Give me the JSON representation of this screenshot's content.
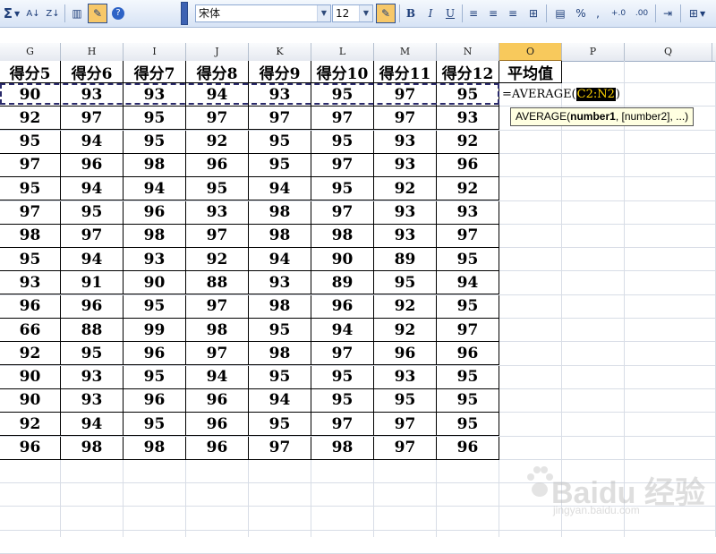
{
  "toolbar": {
    "sum_icon_label": "Σ",
    "font_name": "宋体",
    "font_size": "12",
    "bold": "B",
    "italic": "I",
    "underline": "U",
    "percent": "%",
    "comma": ",",
    "inc_decimal": "+.0",
    "dec_decimal": ".00"
  },
  "columns": [
    "G",
    "H",
    "I",
    "J",
    "K",
    "L",
    "M",
    "N",
    "O",
    "P",
    "Q"
  ],
  "active_column": "O",
  "headers": [
    "得分5",
    "得分6",
    "得分7",
    "得分8",
    "得分9",
    "得分10",
    "得分11",
    "得分12",
    "平均值"
  ],
  "rows": [
    [
      90,
      93,
      93,
      94,
      93,
      95,
      97,
      95
    ],
    [
      92,
      97,
      95,
      97,
      97,
      97,
      97,
      93
    ],
    [
      95,
      94,
      95,
      92,
      95,
      95,
      93,
      92
    ],
    [
      97,
      96,
      98,
      96,
      95,
      97,
      93,
      96
    ],
    [
      95,
      94,
      94,
      95,
      94,
      95,
      92,
      92
    ],
    [
      97,
      95,
      96,
      93,
      98,
      97,
      93,
      93
    ],
    [
      98,
      97,
      98,
      97,
      98,
      98,
      93,
      97
    ],
    [
      95,
      94,
      93,
      92,
      94,
      90,
      89,
      95
    ],
    [
      93,
      91,
      90,
      88,
      93,
      89,
      95,
      94
    ],
    [
      96,
      96,
      95,
      97,
      98,
      96,
      92,
      95
    ],
    [
      66,
      88,
      99,
      98,
      95,
      94,
      92,
      97
    ],
    [
      92,
      95,
      96,
      97,
      98,
      97,
      96,
      96
    ],
    [
      90,
      93,
      95,
      94,
      95,
      95,
      93,
      95
    ],
    [
      90,
      93,
      96,
      96,
      94,
      95,
      95,
      95
    ],
    [
      92,
      94,
      95,
      96,
      95,
      97,
      97,
      95
    ],
    [
      96,
      98,
      98,
      96,
      97,
      98,
      97,
      96
    ]
  ],
  "formula": {
    "prefix": "=AVERAGE(",
    "range": "C2:N2",
    "suffix": ")"
  },
  "tooltip": {
    "func": "AVERAGE(",
    "arg1": "number1",
    "rest": ", [number2], ...)"
  },
  "watermark": {
    "brand": "Baidu 经验",
    "url": "jingyan.baidu.com"
  }
}
